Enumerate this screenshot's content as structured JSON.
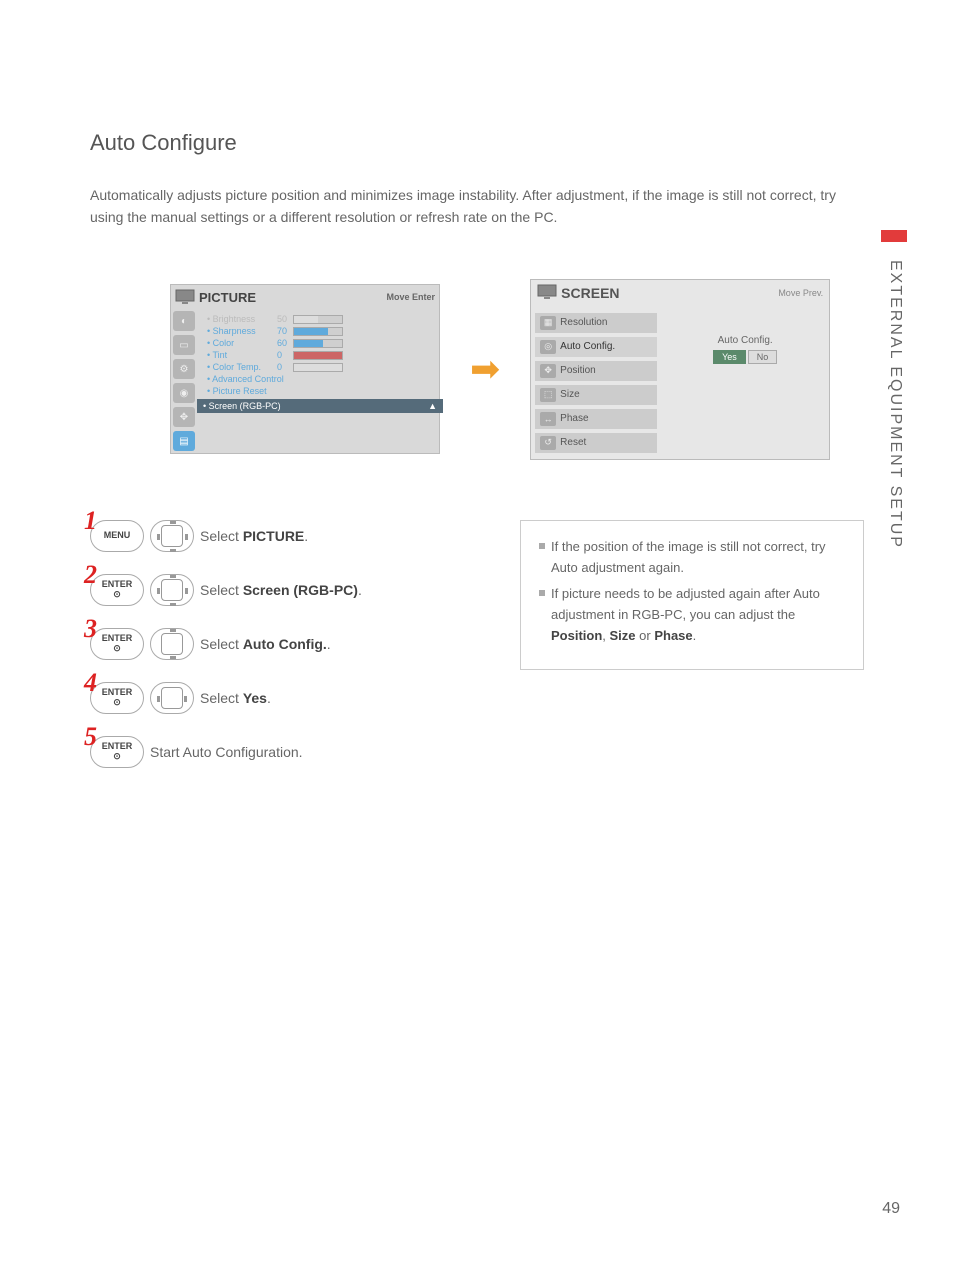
{
  "page": {
    "title": "Auto Configure",
    "intro": "Automatically adjusts picture position and minimizes image instability. After adjustment, if the image is still not correct, try using the manual settings or a different resolution or refresh rate on the PC.",
    "sidebar_label": "EXTERNAL EQUIPMENT SETUP",
    "page_number": "49"
  },
  "picture_menu": {
    "title": "PICTURE",
    "hint": "Move    Enter",
    "items": [
      {
        "label": "• Brightness",
        "value": "50",
        "fill": 50,
        "dim": true
      },
      {
        "label": "• Sharpness",
        "value": "70",
        "fill": 70
      },
      {
        "label": "• Color",
        "value": "60",
        "fill": 60
      },
      {
        "label": "• Tint",
        "value": "0",
        "variant": "rg"
      },
      {
        "label": "• Color Temp.",
        "value": "0",
        "variant": "wc"
      },
      {
        "label": "• Advanced Control"
      },
      {
        "label": "• Picture Reset"
      }
    ],
    "selected": "• Screen (RGB-PC)"
  },
  "screen_menu": {
    "title": "SCREEN",
    "hint": "Move    Prev.",
    "items": [
      "Resolution",
      "Auto Config.",
      "Position",
      "Size",
      "Phase",
      "Reset"
    ],
    "right_label": "Auto Config.",
    "yes": "Yes",
    "no": "No"
  },
  "steps": [
    {
      "num": "1",
      "btn": "MENU",
      "nav": "all",
      "text_prefix": "Select ",
      "text_bold": "PICTURE",
      "text_suffix": "."
    },
    {
      "num": "2",
      "btn": "ENTER",
      "nav": "all",
      "text_prefix": "Select ",
      "text_bold": "Screen (RGB-PC)",
      "text_suffix": "."
    },
    {
      "num": "3",
      "btn": "ENTER",
      "nav": "ud",
      "text_prefix": "Select ",
      "text_bold": "Auto Config.",
      "text_suffix": "."
    },
    {
      "num": "4",
      "btn": "ENTER",
      "nav": "lr",
      "text_prefix": "Select ",
      "text_bold": "Yes",
      "text_suffix": "."
    },
    {
      "num": "5",
      "btn": "ENTER",
      "nav": "",
      "text_prefix": "Start Auto Configuration.",
      "text_bold": "",
      "text_suffix": ""
    }
  ],
  "notes": [
    {
      "pre": "If the position of the image is still not correct, try Auto adjustment again."
    },
    {
      "pre": "If picture needs to be adjusted again after Auto adjustment in RGB-PC, you can adjust the ",
      "b1": "Position",
      "mid": ", ",
      "b2": "Size",
      "post": " or ",
      "b3": "Phase",
      "end": "."
    }
  ]
}
